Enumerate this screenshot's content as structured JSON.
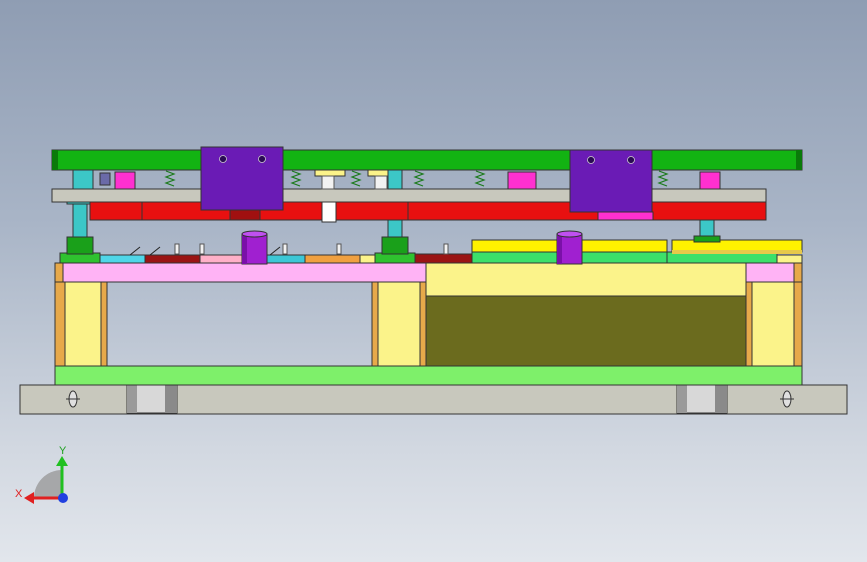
{
  "triad": {
    "x_label": "X",
    "y_label": "Y",
    "colors": {
      "x": "#e02020",
      "y": "#20c020",
      "z": "#2040e0"
    }
  },
  "colors": {
    "background_top": "#8f9db3",
    "background_bottom": "#e2e6ec",
    "top_plate": "#12b312",
    "stripper_plate": "#e81010",
    "guide_block": "#6a1bb5",
    "lower_plate": "#ffb3f5",
    "parallel_block": "#fbf38a",
    "cavity": "#6b6b1e",
    "base_plate": "#7ef06a",
    "bottom_plate": "#c8c8bd"
  }
}
